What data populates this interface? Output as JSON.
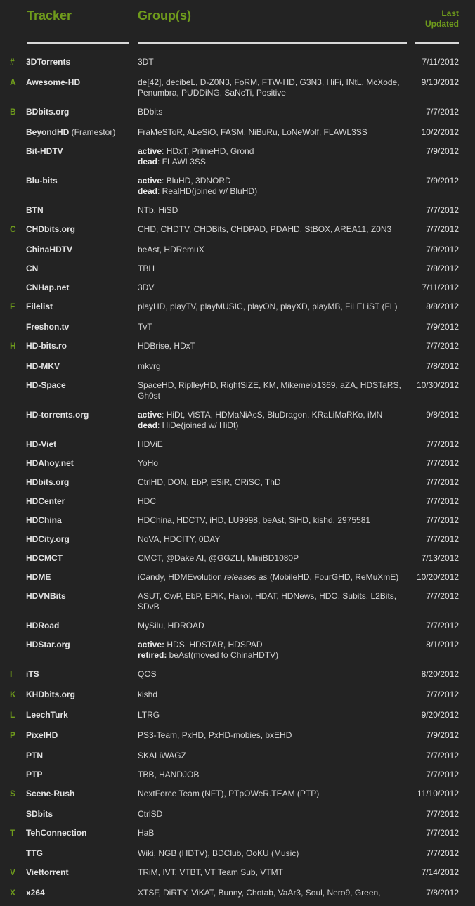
{
  "header": {
    "tracker": "Tracker",
    "groups": "Group(s)",
    "updated_line1": "Last",
    "updated_line2": "Updated"
  },
  "colors": {
    "accent": "#6f9b1c",
    "background": "#232323",
    "text": "#d6d6d6"
  },
  "rows": [
    {
      "letter": "#",
      "tracker": "3DTorrents",
      "sub": "",
      "lines": [
        {
          "lead": "",
          "text": "3DT"
        }
      ],
      "date": "7/11/2012",
      "h": 29
    },
    {
      "letter": "A",
      "tracker": "Awesome-HD",
      "sub": "",
      "lines": [
        {
          "lead": "",
          "text": "de[42], decibeL, D-Z0N3, FoRM, FTW-HD, G3N3, HiFi, INtL, McXode,"
        },
        {
          "lead": "",
          "text": "Penumbra, PUDDiNG, SaNcTi, Positive"
        }
      ],
      "date": "9/13/2012",
      "h": 42
    },
    {
      "letter": "B",
      "tracker": "BDbits.org",
      "sub": "",
      "lines": [
        {
          "lead": "",
          "text": "BDbits"
        }
      ],
      "date": "7/7/2012",
      "h": 29
    },
    {
      "letter": "",
      "tracker": "BeyondHD",
      "sub": " (Framestor)",
      "lines": [
        {
          "lead": "",
          "text": "FraMeSToR, ALeSiO, FASM, NiBuRu, LoNeWolf, FLAWL3SS"
        }
      ],
      "date": "10/2/2012",
      "h": 27
    },
    {
      "letter": "",
      "tracker": "Bit-HDTV",
      "sub": "",
      "lines": [
        {
          "lead": "active",
          "text": ": HDxT, PrimeHD, Grond"
        },
        {
          "lead": "dead",
          "text": ": FLAWL3SS"
        }
      ],
      "date": "7/9/2012",
      "h": 42
    },
    {
      "letter": "",
      "tracker": "Blu-bits",
      "sub": "",
      "lines": [
        {
          "lead": "active",
          "text": ": BluHD, 3DNORD"
        },
        {
          "lead": "dead",
          "text": ": RealHD(joined w/ BluHD)"
        }
      ],
      "date": "7/9/2012",
      "h": 42
    },
    {
      "letter": "",
      "tracker": "BTN",
      "sub": "",
      "lines": [
        {
          "lead": "",
          "text": "NTb, HiSD"
        }
      ],
      "date": "7/7/2012",
      "h": 27
    },
    {
      "letter": "C",
      "tracker": "CHDbits.org",
      "sub": "",
      "lines": [
        {
          "lead": "",
          "text": "CHD, CHDTV, CHDBits, CHDPAD, PDAHD, StBOX, AREA11, Z0N3"
        }
      ],
      "date": "7/7/2012",
      "h": 29
    },
    {
      "letter": "",
      "tracker": "ChinaHDTV",
      "sub": "",
      "lines": [
        {
          "lead": "",
          "text": "beAst, HDRemuX"
        }
      ],
      "date": "7/9/2012",
      "h": 27
    },
    {
      "letter": "",
      "tracker": "CN",
      "sub": "",
      "lines": [
        {
          "lead": "",
          "text": "TBH"
        }
      ],
      "date": "7/8/2012",
      "h": 27
    },
    {
      "letter": "",
      "tracker": "CNHap.net",
      "sub": "",
      "lines": [
        {
          "lead": "",
          "text": "3DV"
        }
      ],
      "date": "7/11/2012",
      "h": 27
    },
    {
      "letter": "F",
      "tracker": "Filelist",
      "sub": "",
      "lines": [
        {
          "lead": "",
          "text": "playHD, playTV, playMUSIC, playON, playXD, playMB, FiLELiST (FL)"
        }
      ],
      "date": "8/8/2012",
      "h": 29
    },
    {
      "letter": "",
      "tracker": "Freshon.tv",
      "sub": "",
      "lines": [
        {
          "lead": "",
          "text": "TvT"
        }
      ],
      "date": "7/9/2012",
      "h": 27
    },
    {
      "letter": "H",
      "tracker": "HD-bits.ro",
      "sub": "",
      "lines": [
        {
          "lead": "",
          "text": "HDBrise, HDxT"
        }
      ],
      "date": "7/7/2012",
      "h": 29
    },
    {
      "letter": "",
      "tracker": "HD-MKV",
      "sub": "",
      "lines": [
        {
          "lead": "",
          "text": "mkvrg"
        }
      ],
      "date": "7/8/2012",
      "h": 27
    },
    {
      "letter": "",
      "tracker": "HD-Space",
      "sub": "",
      "lines": [
        {
          "lead": "",
          "text": "SpaceHD, RiplleyHD, RightSiZE, KM, Mikemelo1369, aZA, HDSTaRS,"
        },
        {
          "lead": "",
          "text": "Gh0st"
        }
      ],
      "date": "10/30/2012",
      "h": 42
    },
    {
      "letter": "",
      "tracker": "HD-torrents.org",
      "sub": "",
      "lines": [
        {
          "lead": "active",
          "text": ": HiDt, ViSTA, HDMaNiAcS, BluDragon, KRaLiMaRKo, iMN"
        },
        {
          "lead": "dead",
          "text": ": HiDe(joined w/ HiDt)"
        }
      ],
      "date": "9/8/2012",
      "h": 42
    },
    {
      "letter": "",
      "tracker": "HD-Viet",
      "sub": "",
      "lines": [
        {
          "lead": "",
          "text": "HDViE"
        }
      ],
      "date": "7/7/2012",
      "h": 27
    },
    {
      "letter": "",
      "tracker": "HDAhoy.net",
      "sub": "",
      "lines": [
        {
          "lead": "",
          "text": "YoHo"
        }
      ],
      "date": "7/7/2012",
      "h": 27
    },
    {
      "letter": "",
      "tracker": "HDbits.org",
      "sub": "",
      "lines": [
        {
          "lead": "",
          "text": "CtrlHD, DON, EbP, ESiR, CRiSC, ThD"
        }
      ],
      "date": "7/7/2012",
      "h": 27
    },
    {
      "letter": "",
      "tracker": "HDCenter",
      "sub": "",
      "lines": [
        {
          "lead": "",
          "text": "HDC"
        }
      ],
      "date": "7/7/2012",
      "h": 27
    },
    {
      "letter": "",
      "tracker": "HDChina",
      "sub": "",
      "lines": [
        {
          "lead": "",
          "text": "HDChina, HDCTV, iHD, LU9998, beAst, SiHD, kishd, 2975581"
        }
      ],
      "date": "7/7/2012",
      "h": 27
    },
    {
      "letter": "",
      "tracker": "HDCity.org",
      "sub": "",
      "lines": [
        {
          "lead": "",
          "text": "NoVA, HDCITY, 0DAY"
        }
      ],
      "date": "7/7/2012",
      "h": 27
    },
    {
      "letter": "",
      "tracker": "HDCMCT",
      "sub": "",
      "lines": [
        {
          "lead": "",
          "text": "CMCT, @Dake AI, @GGZLI, MiniBD1080P"
        }
      ],
      "date": "7/13/2012",
      "h": 27
    },
    {
      "letter": "",
      "tracker": "HDME",
      "sub": "",
      "lines": [
        {
          "lead": "",
          "text": "iCandy, HDMEvolution ",
          "ital": "releases as",
          "tail": " (MobileHD, FourGHD, ReMuXmE)"
        }
      ],
      "date": "10/20/2012",
      "h": 27
    },
    {
      "letter": "",
      "tracker": "HDVNBits",
      "sub": "",
      "lines": [
        {
          "lead": "",
          "text": "ASUT, CwP, EbP, EPiK, Hanoi, HDAT, HDNews, HDO, Subits, L2Bits,"
        },
        {
          "lead": "",
          "text": "SDvB"
        }
      ],
      "date": "7/7/2012",
      "h": 42
    },
    {
      "letter": "",
      "tracker": "HDRoad",
      "sub": "",
      "lines": [
        {
          "lead": "",
          "text": "MySilu, HDROAD"
        }
      ],
      "date": "7/7/2012",
      "h": 27
    },
    {
      "letter": "",
      "tracker": "HDStar.org",
      "sub": "",
      "lines": [
        {
          "lead": "active:",
          "text": " HDS, HDSTAR, HDSPAD"
        },
        {
          "lead": "retired:",
          "text": " beAst(moved to ChinaHDTV)"
        }
      ],
      "date": "8/1/2012",
      "h": 42
    },
    {
      "letter": "I",
      "tracker": "iTS",
      "sub": "",
      "lines": [
        {
          "lead": "",
          "text": "QOS"
        }
      ],
      "date": "8/20/2012",
      "h": 29
    },
    {
      "letter": "K",
      "tracker": "KHDbits.org",
      "sub": "",
      "lines": [
        {
          "lead": "",
          "text": "kishd"
        }
      ],
      "date": "7/7/2012",
      "h": 29
    },
    {
      "letter": "L",
      "tracker": "LeechTurk",
      "sub": "",
      "lines": [
        {
          "lead": "",
          "text": "LTRG"
        }
      ],
      "date": "9/20/2012",
      "h": 29
    },
    {
      "letter": "P",
      "tracker": "PixelHD",
      "sub": "",
      "lines": [
        {
          "lead": "",
          "text": "PS3-Team, PxHD, PxHD-mobies, bxEHD"
        }
      ],
      "date": "7/9/2012",
      "h": 29
    },
    {
      "letter": "",
      "tracker": "PTN",
      "sub": "",
      "lines": [
        {
          "lead": "",
          "text": "SKALiWAGZ"
        }
      ],
      "date": "7/7/2012",
      "h": 27
    },
    {
      "letter": "",
      "tracker": "PTP",
      "sub": "",
      "lines": [
        {
          "lead": "",
          "text": "TBB, HANDJOB"
        }
      ],
      "date": "7/7/2012",
      "h": 27
    },
    {
      "letter": "S",
      "tracker": "Scene-Rush",
      "sub": "",
      "lines": [
        {
          "lead": "",
          "text": "NextForce Team (NFT), PTpOWeR.TEAM (PTP)"
        }
      ],
      "date": "11/10/2012",
      "h": 29
    },
    {
      "letter": "",
      "tracker": "SDbits",
      "sub": "",
      "lines": [
        {
          "lead": "",
          "text": "CtrlSD"
        }
      ],
      "date": "7/7/2012",
      "h": 27
    },
    {
      "letter": "T",
      "tracker": "TehConnection",
      "sub": "",
      "lines": [
        {
          "lead": "",
          "text": "HaB"
        }
      ],
      "date": "7/7/2012",
      "h": 29
    },
    {
      "letter": "",
      "tracker": "TTG",
      "sub": "",
      "lines": [
        {
          "lead": "",
          "text": "Wiki, NGB (HDTV), BDClub, OoKU (Music)"
        }
      ],
      "date": "7/7/2012",
      "h": 27
    },
    {
      "letter": "V",
      "tracker": "Viettorrent",
      "sub": "",
      "lines": [
        {
          "lead": "",
          "text": "TRiM, IVT, VTBT, VT Team Sub, VTMT"
        }
      ],
      "date": "7/14/2012",
      "h": 29
    },
    {
      "letter": "X",
      "tracker": "x264",
      "sub": "",
      "lines": [
        {
          "lead": "",
          "text": "XTSF, DiRTY, ViKAT, Bunny, Chotab, VaAr3, Soul, Nero9, Green,"
        }
      ],
      "date": "7/8/2012",
      "h": 27
    }
  ]
}
